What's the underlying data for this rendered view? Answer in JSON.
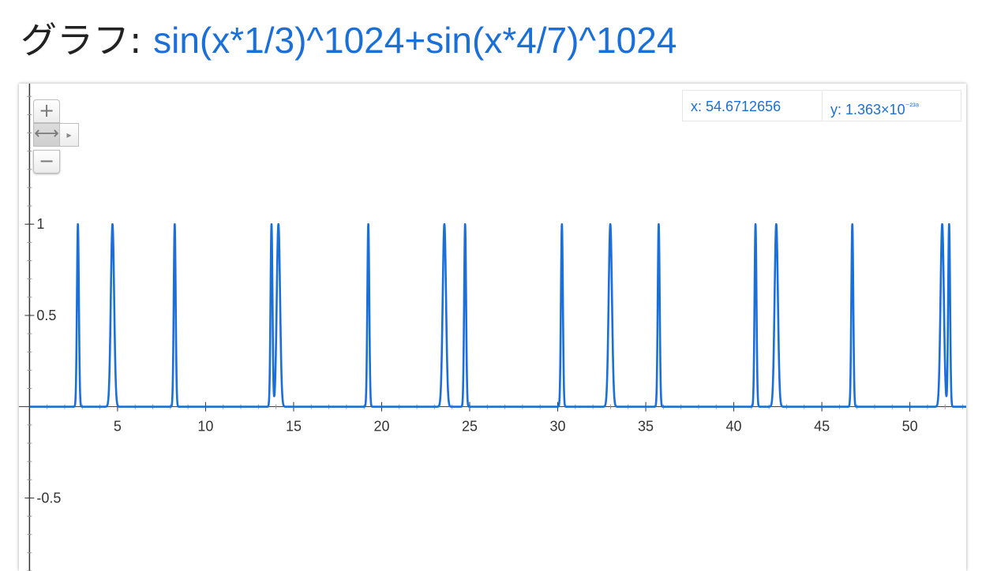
{
  "heading": {
    "prefix": "グラフ: ",
    "formula": "sin(x*1/3)^1024+sin(x*4/7)^1024"
  },
  "readout": {
    "x_label": "x: 54.6712656",
    "y_mantissa": "y: 1.363×10",
    "y_exponent": "⁻²³⁸"
  },
  "controls": {
    "zoom_in": "+",
    "pan": "⟷",
    "pan_arrow": "▸",
    "zoom_out": "−"
  },
  "colors": {
    "curve": "#1a6fd8",
    "formula": "#1a6fd8",
    "axis": "#333333"
  },
  "chart_data": {
    "type": "line",
    "function": "sin(x*1/3)^1024+sin(x*4/7)^1024",
    "xlim": [
      -0.6,
      53.2
    ],
    "ylim": [
      -0.9,
      1.77
    ],
    "x_ticks": [
      5,
      10,
      15,
      20,
      25,
      30,
      35,
      40,
      45,
      50
    ],
    "x_tick_labels": [
      "5",
      "10",
      "15",
      "20",
      "25",
      "30",
      "35",
      "40",
      "45",
      "50"
    ],
    "y_ticks": [
      1,
      0.5,
      -0.5
    ],
    "y_tick_labels": [
      "1",
      "0.5",
      "-0.5"
    ],
    "grid": false,
    "peaks_x": [
      2.75,
      4.71,
      8.25,
      13.75,
      14.14,
      19.24,
      23.56,
      24.74,
      30.24,
      32.99,
      35.74,
      41.23,
      42.41,
      46.73,
      51.83,
      52.23
    ]
  }
}
